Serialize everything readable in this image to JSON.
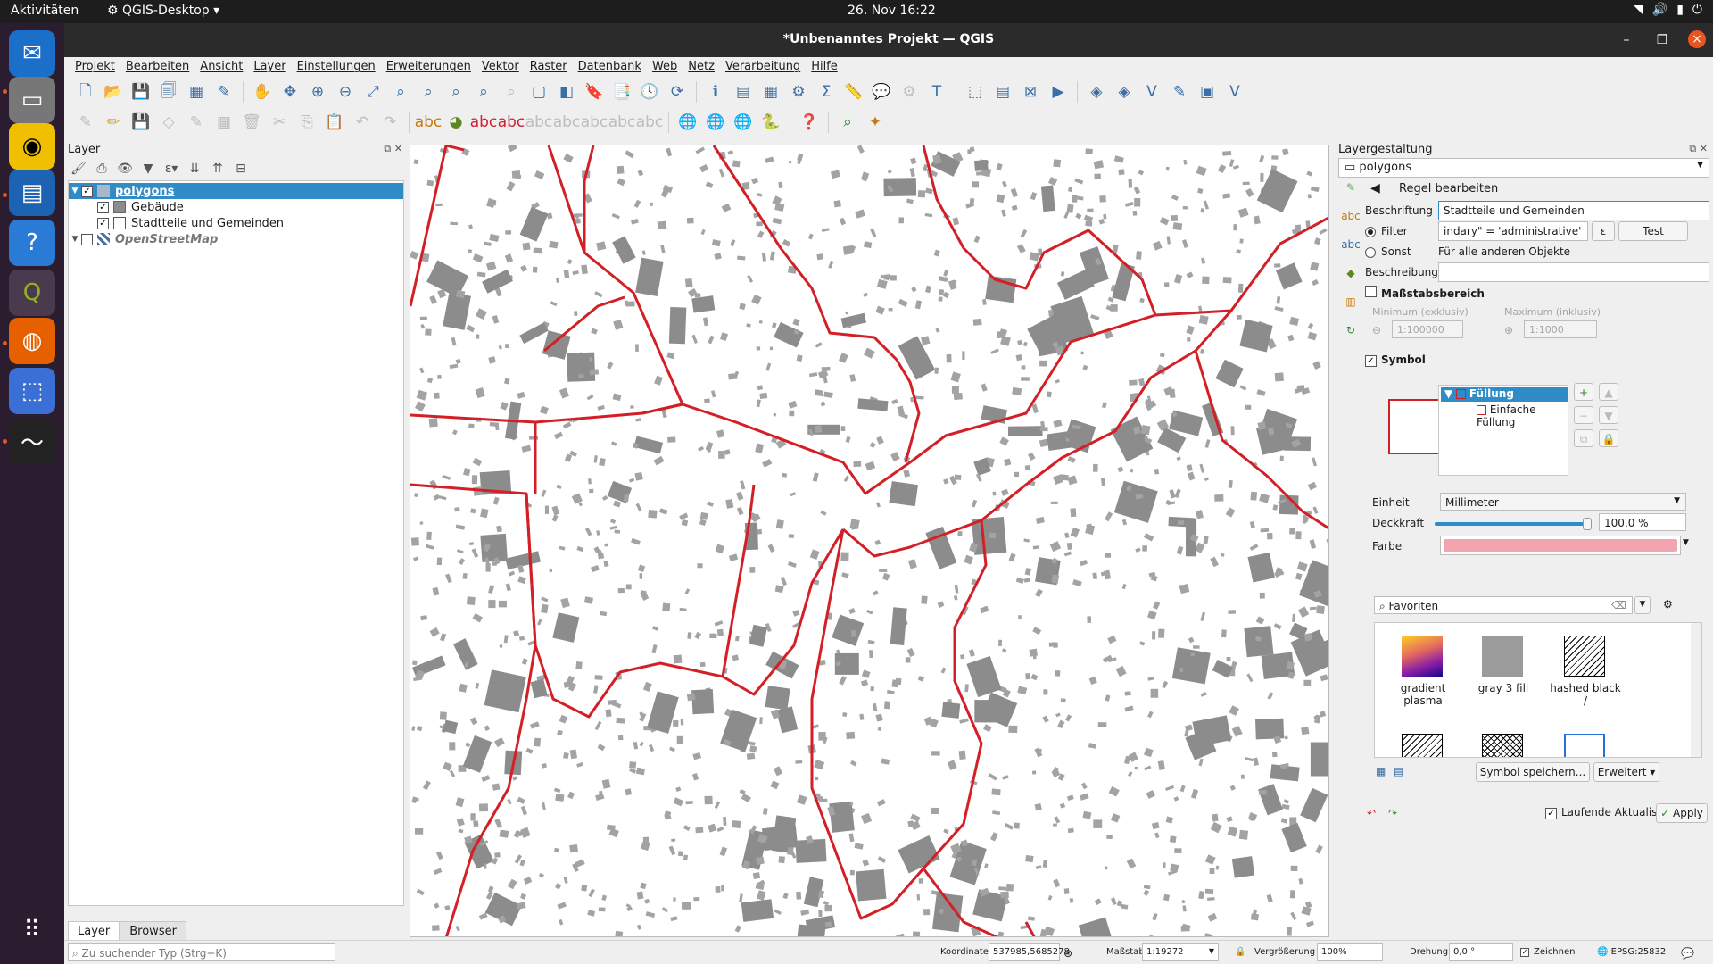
{
  "topbar": {
    "activities": "Aktivitäten",
    "app_menu": "QGIS-Desktop",
    "clock": "26. Nov  16:22"
  },
  "window": {
    "title": "*Unbenanntes Projekt — QGIS"
  },
  "menus": [
    "Projekt",
    "Bearbeiten",
    "Ansicht",
    "Layer",
    "Einstellungen",
    "Erweiterungen",
    "Vektor",
    "Raster",
    "Datenbank",
    "Web",
    "Netz",
    "Verarbeitung",
    "Hilfe"
  ],
  "layer_panel": {
    "title": "Layer",
    "tree": [
      {
        "name": "polygons",
        "checked": true
      },
      {
        "name": "Gebäude",
        "checked": true
      },
      {
        "name": "Stadtteile und Gemeinden",
        "checked": true
      },
      {
        "name": "OpenStreetMap",
        "checked": false
      }
    ],
    "tabs": [
      "Layer",
      "Browser"
    ],
    "locator_placeholder": "Zu suchender Typ (Strg+K)"
  },
  "style_panel": {
    "title": "Layergestaltung",
    "layer": "polygons",
    "rule_header": "Regel bearbeiten",
    "label_caption": "Beschriftung",
    "label_value": "Stadtteile und Gemeinden",
    "filter_caption": "Filter",
    "filter_value": "indary\"  =  'administrative'",
    "epsilon": "ε",
    "test_button": "Test",
    "else_caption": "Sonst",
    "else_text": "Für alle anderen Objekte",
    "description_caption": "Beschreibung",
    "scale_range": "Maßstabsbereich",
    "min_caption": "Minimum (exklusiv)",
    "max_caption": "Maximum (inklusiv)",
    "min_value": "1:100000",
    "max_value": "1:1000",
    "symbol_caption": "Symbol",
    "symbol_tree": [
      "Füllung",
      "Einfache Füllung"
    ],
    "unit_caption": "Einheit",
    "unit_value": "Millimeter",
    "opacity_caption": "Deckkraft",
    "opacity_value": "100,0 %",
    "opacity_fraction": 1.0,
    "color_caption": "Farbe",
    "color_value": "#f2a5ae",
    "search_value": "Favoriten",
    "favorites": [
      {
        "label": "gradient plasma"
      },
      {
        "label": "gray 3 fill"
      },
      {
        "label": "hashed black /"
      }
    ],
    "save_symbol_button": "Symbol speichern...",
    "advanced_button": "Erweitert",
    "live_update": "Laufende Aktualisierung",
    "apply_button": "Apply"
  },
  "statusbar": {
    "coord_caption": "Koordinate",
    "coord_value": "537985,5685278",
    "scale_caption": "Maßstab",
    "scale_value": "1:19272",
    "zoom_caption": "Vergrößerung",
    "zoom_value": "100%",
    "rotation_caption": "Drehung",
    "rotation_value": "0,0 °",
    "render_caption": "Zeichnen",
    "crs": "EPSG:25832"
  },
  "colors": {
    "boundary": "#d31f26",
    "selection": "#308cc6",
    "buildings": "#8c8c8c"
  }
}
